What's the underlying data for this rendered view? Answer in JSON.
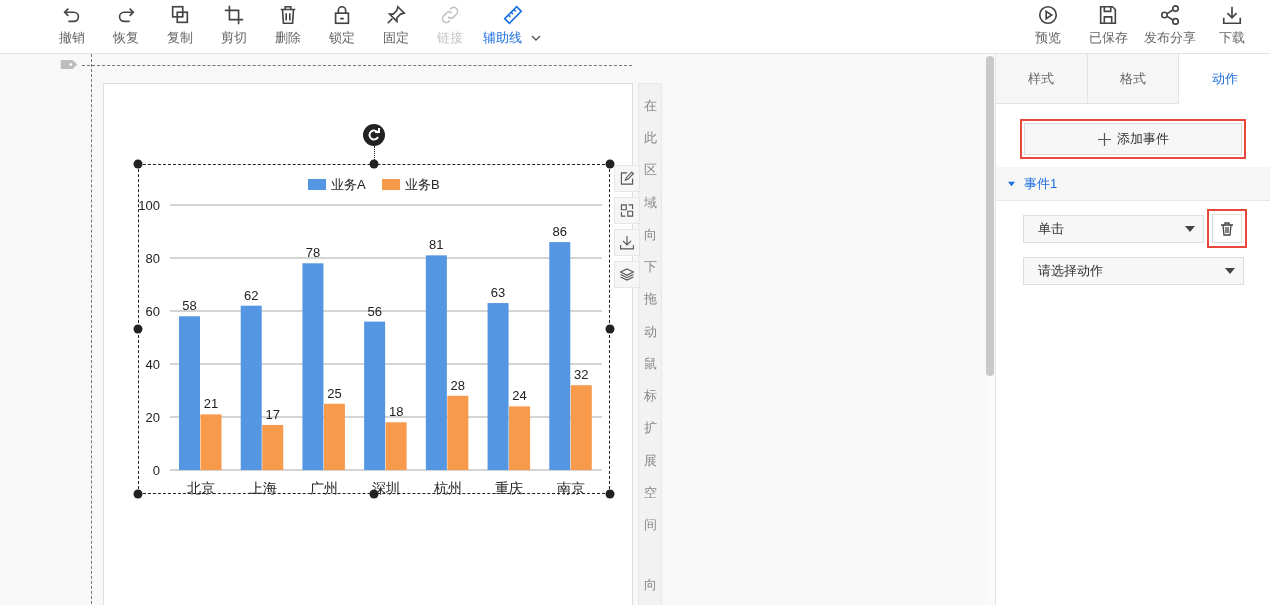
{
  "toolbar": {
    "left": [
      {
        "kind": "undo",
        "label": "撤销",
        "disabled": false,
        "active": false,
        "dropdown": false
      },
      {
        "kind": "redo",
        "label": "恢复",
        "disabled": false,
        "active": false,
        "dropdown": false
      },
      {
        "kind": "copy",
        "label": "复制",
        "disabled": false,
        "active": false,
        "dropdown": false
      },
      {
        "kind": "crop",
        "label": "剪切",
        "disabled": false,
        "active": false,
        "dropdown": false
      },
      {
        "kind": "delete",
        "label": "删除",
        "disabled": false,
        "active": false,
        "dropdown": false
      },
      {
        "kind": "lock",
        "label": "锁定",
        "disabled": false,
        "active": false,
        "dropdown": false
      },
      {
        "kind": "pin",
        "label": "固定",
        "disabled": false,
        "active": false,
        "dropdown": false
      },
      {
        "kind": "link",
        "label": "链接",
        "disabled": true,
        "active": false,
        "dropdown": false
      },
      {
        "kind": "ruler",
        "label": "辅助线",
        "disabled": false,
        "active": true,
        "dropdown": true
      }
    ],
    "right": [
      {
        "kind": "play",
        "label": "预览"
      },
      {
        "kind": "save",
        "label": "已保存"
      },
      {
        "kind": "share",
        "label": "发布分享"
      },
      {
        "kind": "download",
        "label": "下载"
      }
    ]
  },
  "canvas": {
    "hint": "在此区域向下拖动鼠标扩展空间",
    "hint_more": "向",
    "chart_data": {
      "type": "bar",
      "categories": [
        "北京",
        "上海",
        "广州",
        "深圳",
        "杭州",
        "重庆",
        "南京"
      ],
      "series": [
        {
          "name": "业务A",
          "color": "#5596e3",
          "values": [
            58,
            62,
            78,
            56,
            81,
            63,
            86
          ]
        },
        {
          "name": "业务B",
          "color": "#f89a4b",
          "values": [
            21,
            17,
            25,
            18,
            28,
            24,
            32
          ]
        }
      ],
      "ylim": [
        0,
        100
      ],
      "yticks": [
        0,
        20,
        40,
        60,
        80,
        100
      ],
      "data_labels": true,
      "grid": true,
      "legend": true
    }
  },
  "panel": {
    "tabs": [
      {
        "label": "样式",
        "selected": false
      },
      {
        "label": "格式",
        "selected": false
      },
      {
        "label": "动作",
        "selected": true
      }
    ],
    "add_button": {
      "label": "添加事件",
      "highlighted": true
    },
    "events": [
      {
        "title": "事件1",
        "expanded": true,
        "trigger": "单击",
        "action_placeholder": "请选择动作",
        "delete_highlighted": true
      }
    ]
  }
}
